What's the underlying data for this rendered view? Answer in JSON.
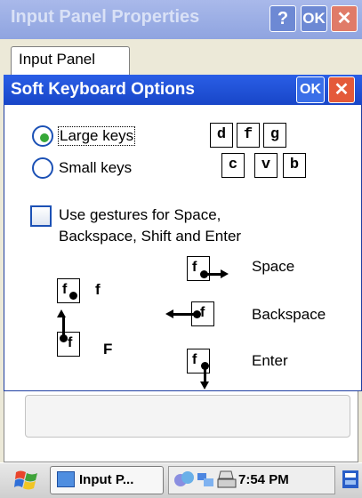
{
  "background_window": {
    "title": "Input Panel Properties",
    "help_label": "?",
    "ok_label": "OK",
    "close_label": "✕",
    "tab_label": "Input Panel"
  },
  "dialog": {
    "title": "Soft Keyboard Options",
    "ok_label": "OK",
    "close_label": "✕",
    "key_size": {
      "options": [
        {
          "label": "Large keys",
          "selected": true
        },
        {
          "label": "Small keys",
          "selected": false
        }
      ]
    },
    "key_preview": {
      "row1": [
        "d",
        "f",
        "g"
      ],
      "row2": [
        "c",
        "v",
        "b"
      ]
    },
    "gestures_checkbox": {
      "label_line1": "Use gestures for Space,",
      "label_line2": "Backspace, Shift and Enter",
      "checked": false
    },
    "gesture_demos": {
      "tap": {
        "key": "f",
        "result": "f"
      },
      "shift": {
        "key": "f",
        "result": "F"
      },
      "space": {
        "key": "f",
        "result": "Space"
      },
      "backspace": {
        "key": "f",
        "result": "Backspace"
      },
      "enter": {
        "key": "f",
        "result": "Enter"
      }
    }
  },
  "taskbar": {
    "task_label": "Input P...",
    "clock": "7:54 PM"
  },
  "colors": {
    "title_active": "#1846c8",
    "title_inactive": "#8fa4e0",
    "radio_dot": "#36a838",
    "close_button": "#e45a3a"
  }
}
